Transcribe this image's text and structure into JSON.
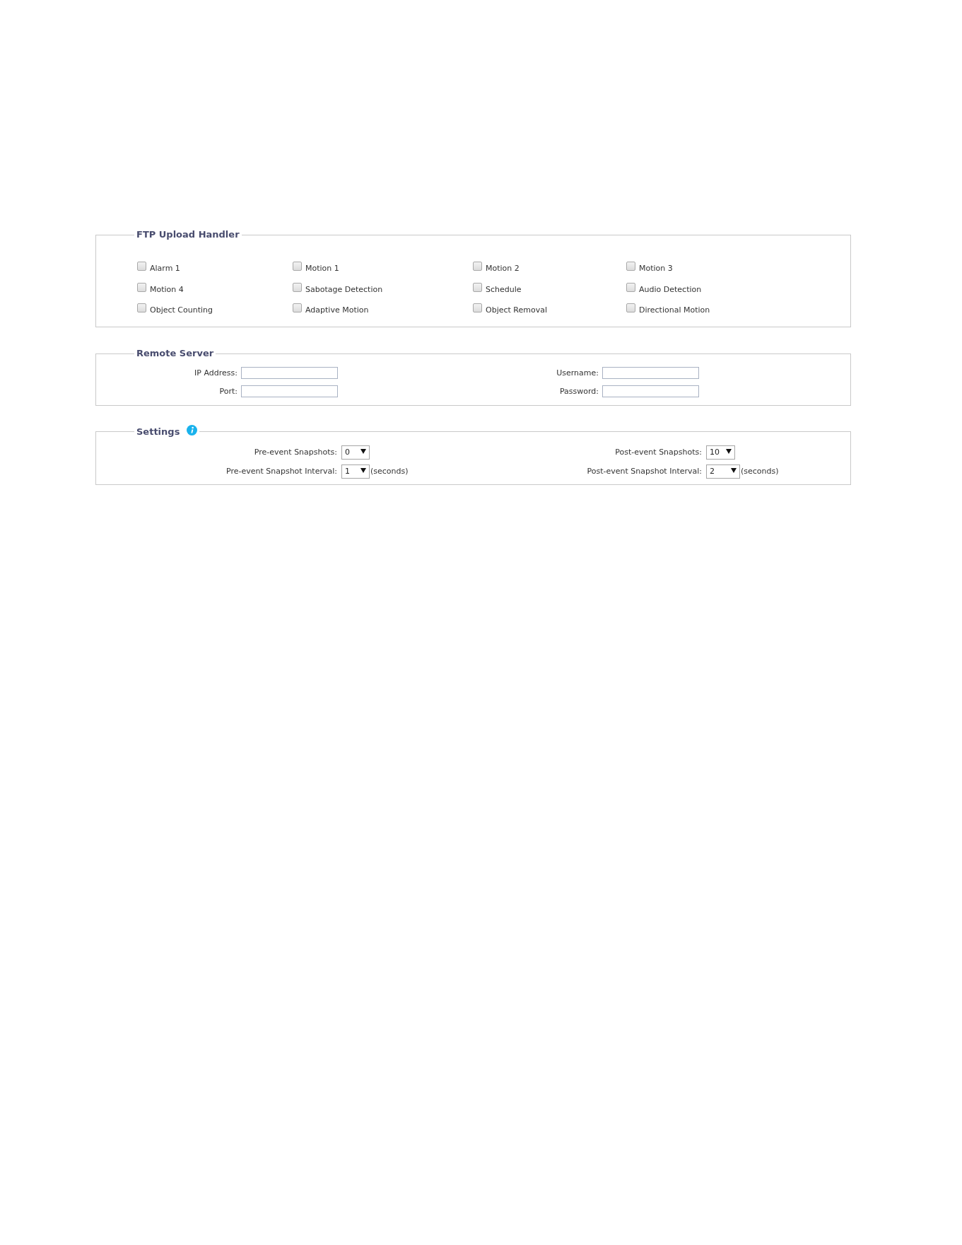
{
  "ftp_upload_handler": {
    "legend": "FTP Upload Handler",
    "options": [
      {
        "label": "Alarm 1",
        "checked": false
      },
      {
        "label": "Motion 1",
        "checked": false
      },
      {
        "label": "Motion 2",
        "checked": false
      },
      {
        "label": "Motion 3",
        "checked": false
      },
      {
        "label": "Motion 4",
        "checked": false
      },
      {
        "label": "Sabotage Detection",
        "checked": false
      },
      {
        "label": "Schedule",
        "checked": false
      },
      {
        "label": "Audio Detection",
        "checked": false
      },
      {
        "label": "Object Counting",
        "checked": false
      },
      {
        "label": "Adaptive Motion",
        "checked": false
      },
      {
        "label": "Object Removal",
        "checked": false
      },
      {
        "label": "Directional Motion",
        "checked": false
      }
    ]
  },
  "remote_server": {
    "legend": "Remote Server",
    "fields": [
      {
        "label": "IP Address:"
      },
      {
        "label": "Username:"
      },
      {
        "label": "Port:"
      },
      {
        "label": "Password:"
      }
    ]
  },
  "settings": {
    "legend": "Settings",
    "fields": [
      {
        "label": "Pre-event Snapshots:",
        "value": "0"
      },
      {
        "label": "Post-event Snapshots:",
        "value": "10"
      },
      {
        "label": "Pre-event Snapshot Interval:",
        "value": "1",
        "unit": "(seconds)"
      },
      {
        "label": "Post-event Snapshot Interval:",
        "value": "2",
        "unit": "(seconds)"
      }
    ]
  }
}
